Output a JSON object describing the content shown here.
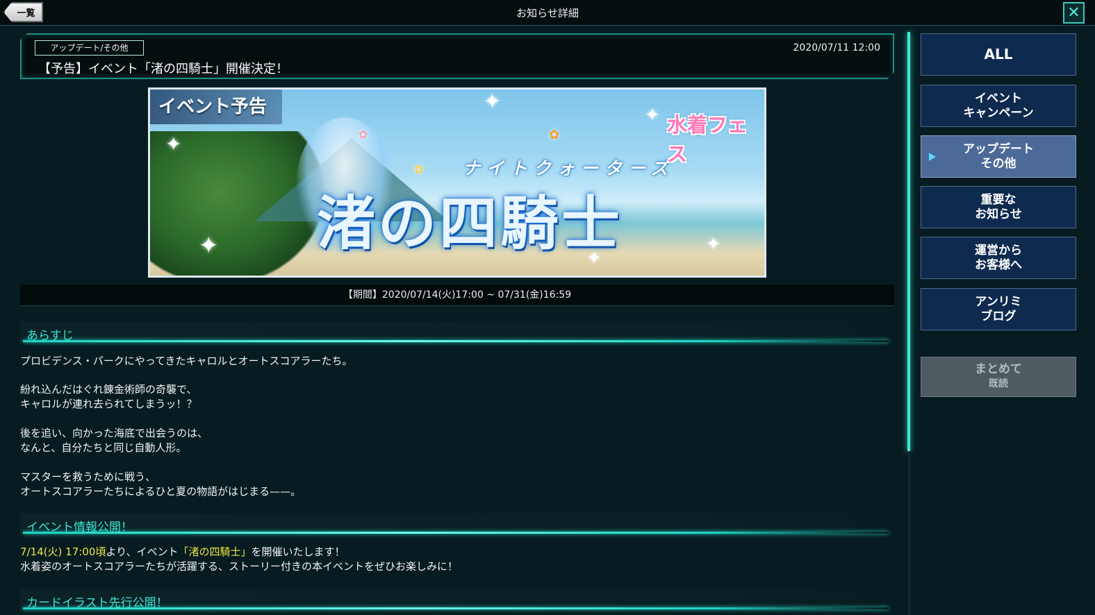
{
  "topbar": {
    "back_label": "一覧",
    "title": "お知らせ詳細",
    "close_glyph": "✕"
  },
  "notice": {
    "category": "アップデート/その他",
    "date": "2020/07/11 12:00",
    "title": "【予告】イベント「渚の四騎士」開催決定！"
  },
  "banner": {
    "tag": "イベント予告",
    "ruby": "ナイトクォーターズ",
    "main": "渚の四騎士",
    "logo": "水着フェス"
  },
  "period": "【期間】2020/07/14(火)17:00 ~ 07/31(金)16:59",
  "sections": {
    "synopsis": {
      "heading": "あらすじ",
      "lines": [
        "プロビデンス・パークにやってきたキャロルとオートスコアラーたち。",
        "紛れ込んだはぐれ錬金術師の奇襲で、",
        "キャロルが連れ去られてしまうッ！？",
        "後を追い、向かった海底で出会うのは、",
        "なんと、自分たちと同じ自動人形。",
        "マスターを救うために戦う、",
        "オートスコアラーたちによるひと夏の物語がはじまる——。"
      ]
    },
    "event_info": {
      "heading": "イベント情報公開！",
      "line1_highlight_time": "7/14(火) 17:00頃",
      "line1_mid": "より、イベント",
      "line1_highlight_name": "「渚の四騎士」",
      "line1_end": "を開催いたします！",
      "line2": "水着姿のオートスコアラーたちが活躍する、ストーリー付きの本イベントをぜひお楽しみに！"
    },
    "card_illust": {
      "heading": "カードイラスト先行公開！"
    }
  },
  "sidebar": {
    "all": "ALL",
    "event_l1": "イベント",
    "event_l2": "キャンペーン",
    "update_l1": "アップデート",
    "update_l2": "その他",
    "important_l1": "重要な",
    "important_l2": "お知らせ",
    "ops_l1": "運営から",
    "ops_l2": "お客様へ",
    "blog_l1": "アンリミ",
    "blog_l2": "ブログ",
    "mark_read_l1": "まとめて",
    "mark_read_l2": "既読"
  },
  "colors": {
    "accent": "#3ee4d6",
    "highlight": "#f1e545",
    "sidebar_active": "#4c6a98"
  }
}
